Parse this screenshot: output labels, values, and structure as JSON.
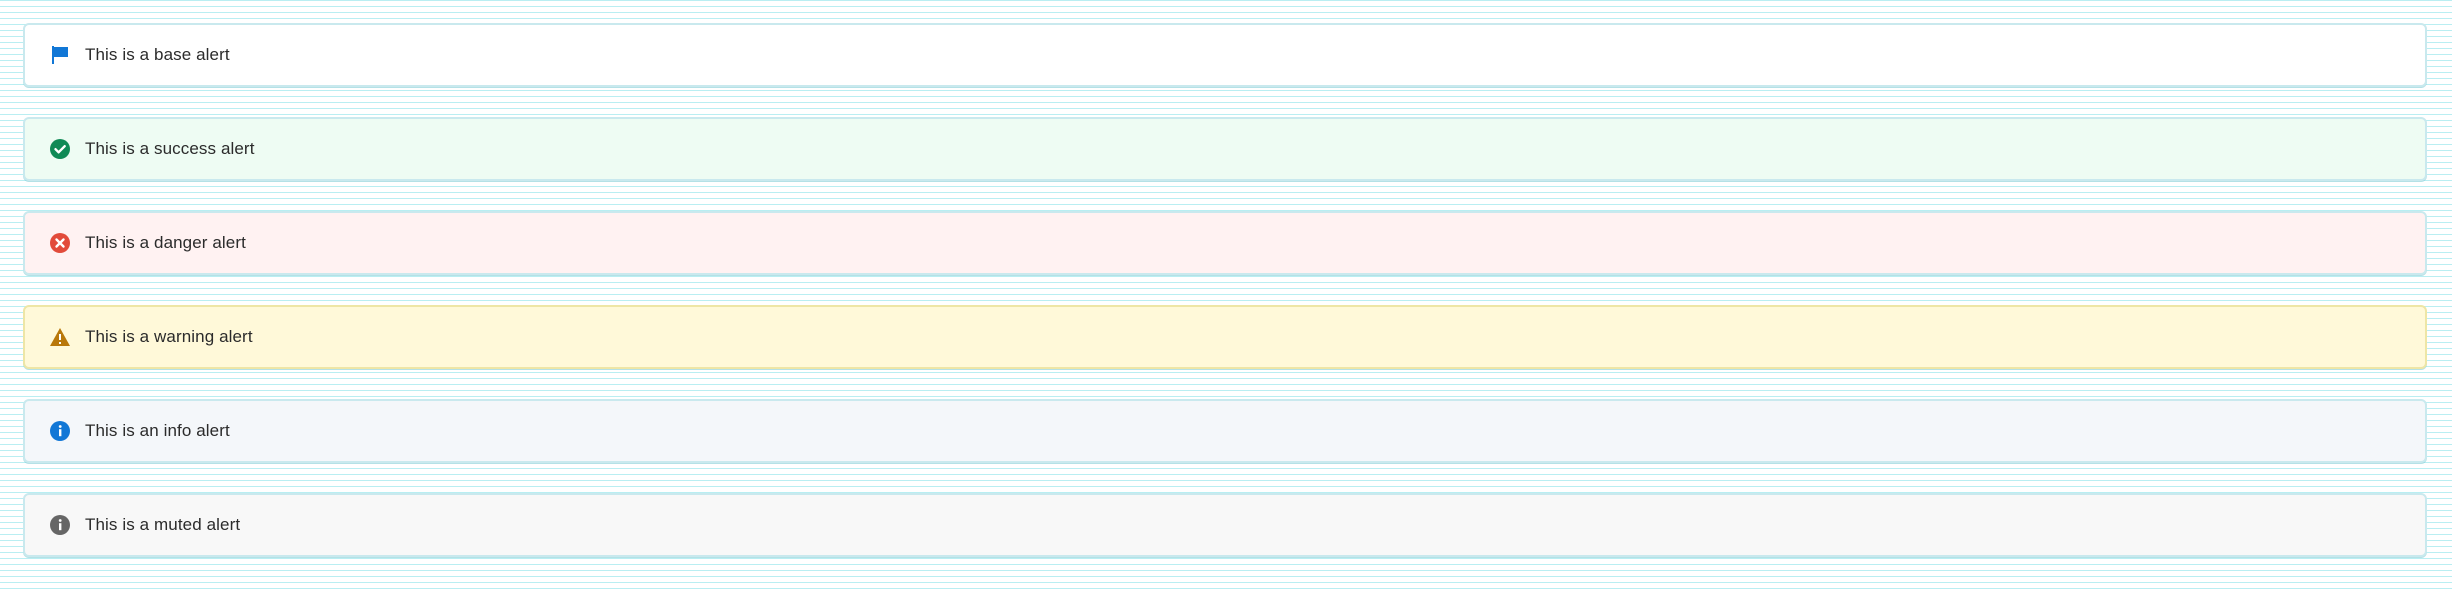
{
  "alerts": [
    {
      "type": "base",
      "text": "This is a base alert",
      "icon": "flag-icon",
      "icon_color": "#1177d6"
    },
    {
      "type": "success",
      "text": "This is a success alert",
      "icon": "check-circle-icon",
      "icon_color": "#108a56"
    },
    {
      "type": "danger",
      "text": "This is a danger alert",
      "icon": "x-circle-icon",
      "icon_color": "#e24b3b"
    },
    {
      "type": "warning",
      "text": "This is a warning alert",
      "icon": "warning-triangle-icon",
      "icon_color": "#b8780a"
    },
    {
      "type": "info",
      "text": "This is an info alert",
      "icon": "info-circle-icon",
      "icon_color": "#1177d6"
    },
    {
      "type": "muted",
      "text": "This is a muted alert",
      "icon": "info-circle-icon",
      "icon_color": "#666666"
    }
  ]
}
